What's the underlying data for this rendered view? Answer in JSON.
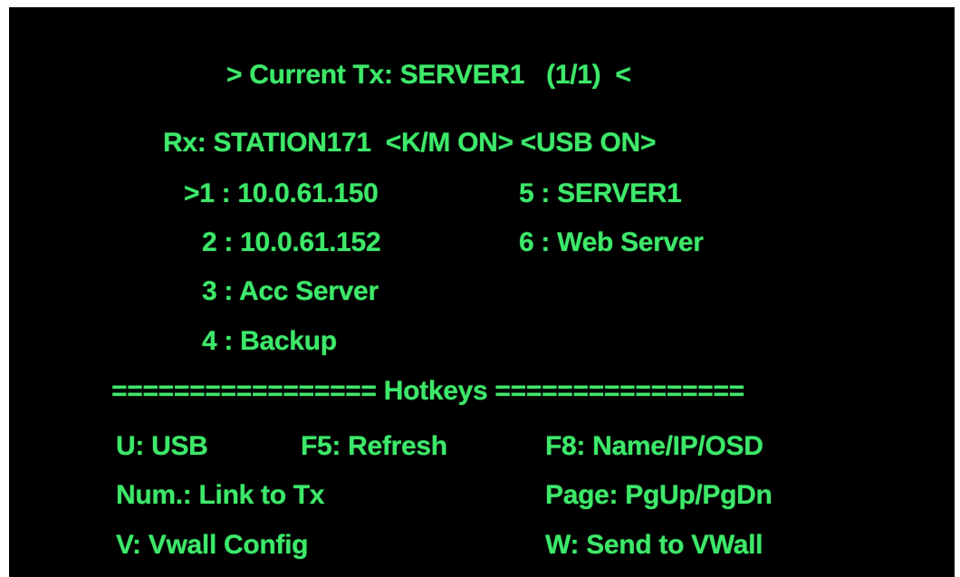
{
  "osd": {
    "header": {
      "current_tx": "> Current Tx: SERVER1   (1/1)  <",
      "rx_line": "Rx: STATION171  <K/M ON> <USB ON>"
    },
    "channels": [
      {
        "label": ">1 : 10.0.61.150",
        "selected": true
      },
      {
        "label": "2 : 10.0.61.152",
        "selected": false
      },
      {
        "label": "3 : Acc Server",
        "selected": false
      },
      {
        "label": "4 : Backup",
        "selected": false
      },
      {
        "label": "5 : SERVER1",
        "selected": false
      },
      {
        "label": "6 : Web Server",
        "selected": false
      }
    ],
    "hotkeys": {
      "divider": "================= Hotkeys ================",
      "items": [
        "U: USB",
        "F5: Refresh",
        "F8: Name/IP/OSD",
        "Num.: Link to Tx",
        "Page: PgUp/PgDn",
        "V: Vwall Config",
        "W: Send to VWall"
      ]
    },
    "colors": {
      "text": "#3ee86a",
      "background": "#000000"
    }
  }
}
